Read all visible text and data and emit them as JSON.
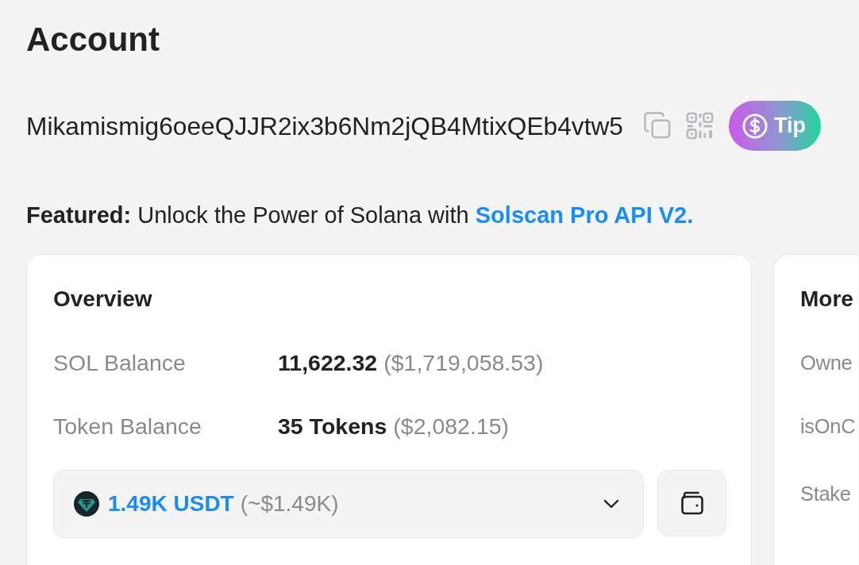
{
  "page": {
    "title": "Account"
  },
  "address": {
    "value": "Mikamismig6oeeQJJR2ix3b6Nm2jQB4MtixQEb4vtw5",
    "tip_label": "Tip"
  },
  "featured": {
    "text": "**Featured:** Unlock the Power of Solana with",
    "link": "Solscan Pro API V2."
  },
  "overview": {
    "title": "Overview",
    "rows": [
      {
        "label": "SOL Balance",
        "value": "11,622.32",
        "note": "($1,719,058.53)"
      },
      {
        "label": "Token Balance",
        "value": "35 Tokens",
        "note": "($2,082.15)"
      }
    ],
    "token_select": {
      "value": "1.49K USDT",
      "note": "(~$1.49K)"
    }
  },
  "more_info": {
    "title": "More",
    "rows": [
      {
        "label": "Owne"
      },
      {
        "label": "isOnC"
      },
      {
        "label": "Stake"
      }
    ]
  }
}
